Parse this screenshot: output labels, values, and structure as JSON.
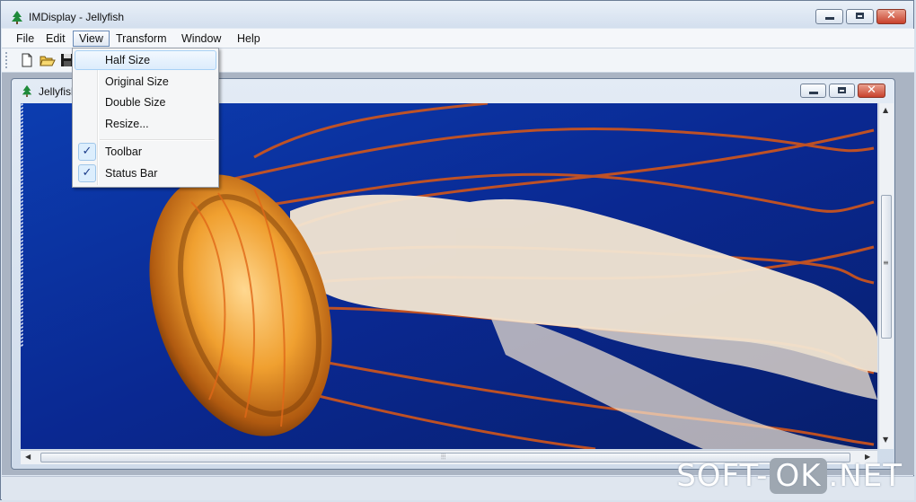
{
  "window": {
    "title": "IMDisplay - Jellyfish"
  },
  "menubar": {
    "items": [
      {
        "label": "File"
      },
      {
        "label": "Edit"
      },
      {
        "label": "View",
        "active": true
      },
      {
        "label": "Transform"
      },
      {
        "label": "Window"
      },
      {
        "label": "Help"
      }
    ]
  },
  "toolbar": {
    "buttons": [
      "new-file-icon",
      "open-folder-icon",
      "save-icon"
    ]
  },
  "view_menu": {
    "items": [
      {
        "label": "Half Size",
        "highlighted": true,
        "checked": false
      },
      {
        "label": "Original Size",
        "checked": false
      },
      {
        "label": "Double Size",
        "checked": false
      },
      {
        "label": "Resize...",
        "checked": false
      },
      {
        "label": "Toolbar",
        "checked": true
      },
      {
        "label": "Status Bar",
        "checked": true
      }
    ]
  },
  "child_window": {
    "title": "Jellyfish"
  },
  "watermark": {
    "part1": "SOFT-",
    "part2": "OK",
    "part3": ".NET"
  },
  "colors": {
    "accent": "#3c6fb5",
    "close_button": "#c8412c",
    "image_bg": "#0a2a8a"
  }
}
